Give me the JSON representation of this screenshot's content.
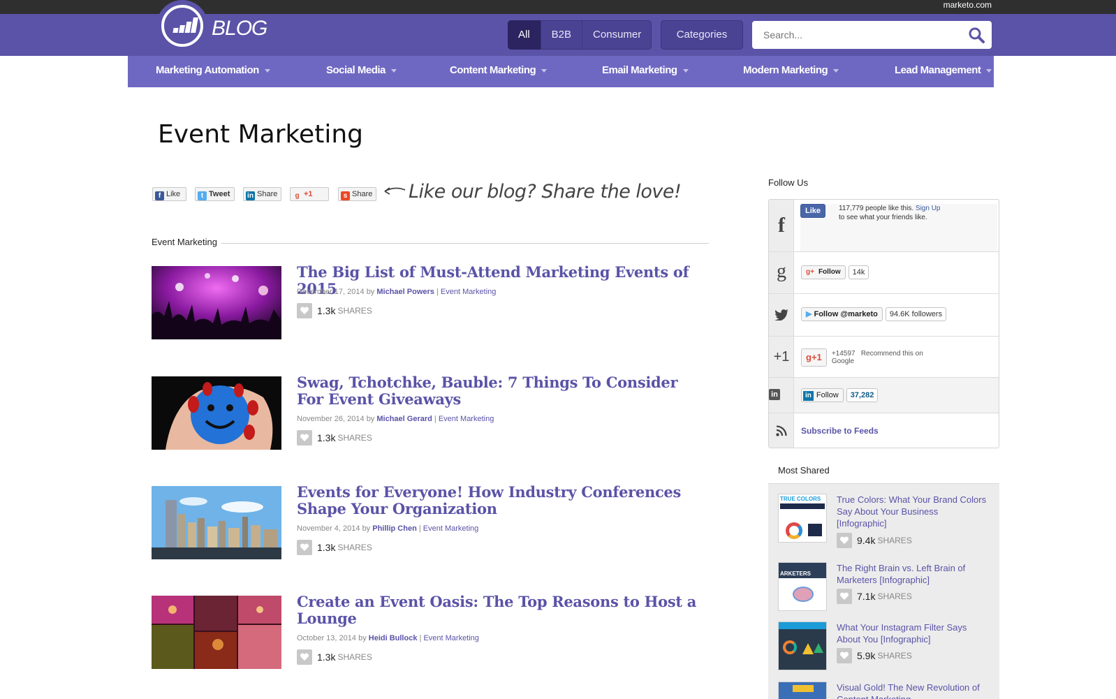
{
  "topbar": {
    "site": "marketo.com"
  },
  "header": {
    "logo_text": "BLOG",
    "filters": [
      "All",
      "B2B",
      "Consumer"
    ],
    "categories_label": "Categories",
    "search_placeholder": "Search..."
  },
  "nav": [
    "Marketing Automation",
    "Social Media",
    "Content Marketing",
    "Email Marketing",
    "Modern Marketing",
    "Lead Management"
  ],
  "page_title": "Event Marketing",
  "share": {
    "like": "Like",
    "tweet": "Tweet",
    "linkedin": "Share",
    "gplus": "+1",
    "stumble": "Share",
    "tagline": "Like our blog? Share the love!"
  },
  "section_label": "Event Marketing",
  "posts": [
    {
      "title": "The Big List of Must-Attend Marketing Events of 2015",
      "date": "December 17, 2014",
      "by": "by",
      "author": "Michael Powers",
      "category": "Event Marketing",
      "shares": "1.3k",
      "shares_label": "SHARES"
    },
    {
      "title": "Swag, Tchotchke, Bauble: 7 Things To Consider For Event Giveaways",
      "date": "November 26, 2014",
      "by": "by",
      "author": "Michael Gerard",
      "category": "Event Marketing",
      "shares": "1.3k",
      "shares_label": "SHARES"
    },
    {
      "title": "Events for Everyone! How Industry Conferences Shape Your Organization",
      "date": "November 4, 2014",
      "by": "by",
      "author": "Phillip Chen",
      "category": "Event Marketing",
      "shares": "1.3k",
      "shares_label": "SHARES"
    },
    {
      "title": "Create an Event Oasis: The Top Reasons to Host a Lounge",
      "date": "October 13, 2014",
      "by": "by",
      "author": "Heidi Bullock",
      "category": "Event Marketing",
      "shares": "1.3k",
      "shares_label": "SHARES"
    }
  ],
  "sidebar": {
    "follow_label": "Follow Us",
    "facebook": {
      "like": "Like",
      "text": "117,779 people like this.",
      "signup": "Sign Up",
      "text2": "to see what your friends like."
    },
    "googleplus": {
      "follow": "Follow",
      "count": "14k"
    },
    "twitter": {
      "follow": "Follow @marketo",
      "count": "94.6K followers"
    },
    "plusone": {
      "count": "+14597",
      "text": "Recommend this on Google"
    },
    "linkedin": {
      "follow": "Follow",
      "count": "37,282"
    },
    "rss": {
      "label": "Subscribe to Feeds"
    },
    "most_shared_label": "Most Shared",
    "most_shared": [
      {
        "title": "True Colors: What Your Brand Colors Say About Your Business [Infographic]",
        "shares": "9.4k",
        "shares_label": "SHARES",
        "thumb_text": "TRUE COLORS"
      },
      {
        "title": "The Right Brain vs. Left Brain of Marketers [Infographic]",
        "shares": "7.1k",
        "shares_label": "SHARES",
        "thumb_text": "ARKETERS"
      },
      {
        "title": "What Your Instagram Filter Says About You [Infographic]",
        "shares": "5.9k",
        "shares_label": "SHARES",
        "thumb_text": ""
      },
      {
        "title": "Visual Gold! The New Revolution of Content Marketing",
        "shares": "",
        "shares_label": "",
        "thumb_text": ""
      }
    ]
  }
}
